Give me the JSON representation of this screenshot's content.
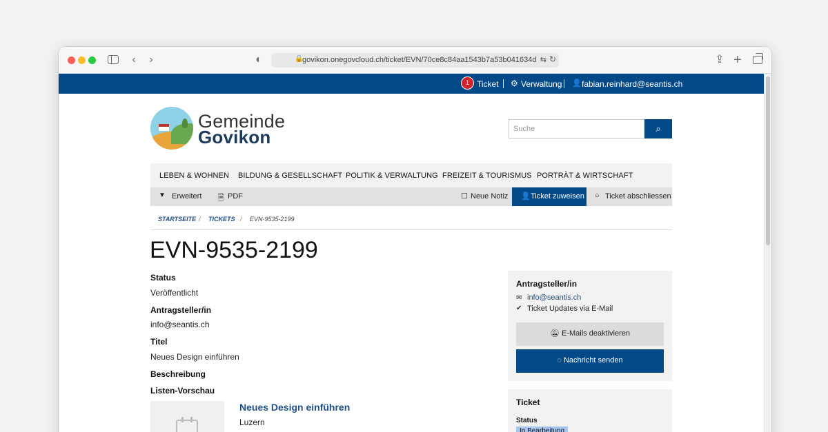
{
  "browser": {
    "url": "govikon.onegovcloud.ch/ticket/EVN/70ce8c84aa1543b7a53b041634db2f75"
  },
  "topbar": {
    "ticket_count": "1",
    "ticket_label": "Ticket",
    "admin_label": "Verwaltung",
    "user_email": "fabian.reinhard@seantis.ch"
  },
  "logo": {
    "line1": "Gemeinde",
    "line2": "Govikon"
  },
  "search": {
    "placeholder": "Suche"
  },
  "main_nav": [
    {
      "label": "LEBEN & WOHNEN"
    },
    {
      "label": "BILDUNG & GESELLSCHAFT"
    },
    {
      "label": "POLITIK & VERWALTUNG"
    },
    {
      "label": "FREIZEIT & TOURISMUS"
    },
    {
      "label": "PORTRÄT & WIRTSCHAFT"
    }
  ],
  "sub_nav": {
    "expand_label": "Erweitert",
    "pdf_label": "PDF",
    "note_label": "Neue Notiz",
    "assign_label": "Ticket zuweisen",
    "close_label": "Ticket abschliessen"
  },
  "breadcrumb": {
    "home": "STARTSEITE",
    "tickets": "TICKETS",
    "current": "EVN-9535-2199",
    "separator": "/"
  },
  "page_title": "EVN-9535-2199",
  "details": [
    {
      "label": "Status",
      "value": "Veröffentlicht"
    },
    {
      "label": "Antragsteller/in",
      "value": "info@seantis.ch"
    },
    {
      "label": "Titel",
      "value": "Neues Design einführen"
    },
    {
      "label": "Beschreibung",
      "value": ""
    },
    {
      "label": "Listen-Vorschau",
      "value": ""
    }
  ],
  "preview": {
    "title": "Neues Design einführen",
    "location": "Luzern"
  },
  "applicant_panel": {
    "title": "Antragsteller/in",
    "email": "info@seantis.ch",
    "updates_label": "Ticket Updates via E-Mail",
    "mute_button": "E-Mails deaktivieren",
    "message_button": "Nachricht senden"
  },
  "ticket_panel": {
    "title": "Ticket",
    "status_label": "Status",
    "status_value": "In Bearbeitung"
  },
  "colors": {
    "brand": "#044987",
    "badge": "#d1242b",
    "status_chip": "#a7c7f1"
  }
}
